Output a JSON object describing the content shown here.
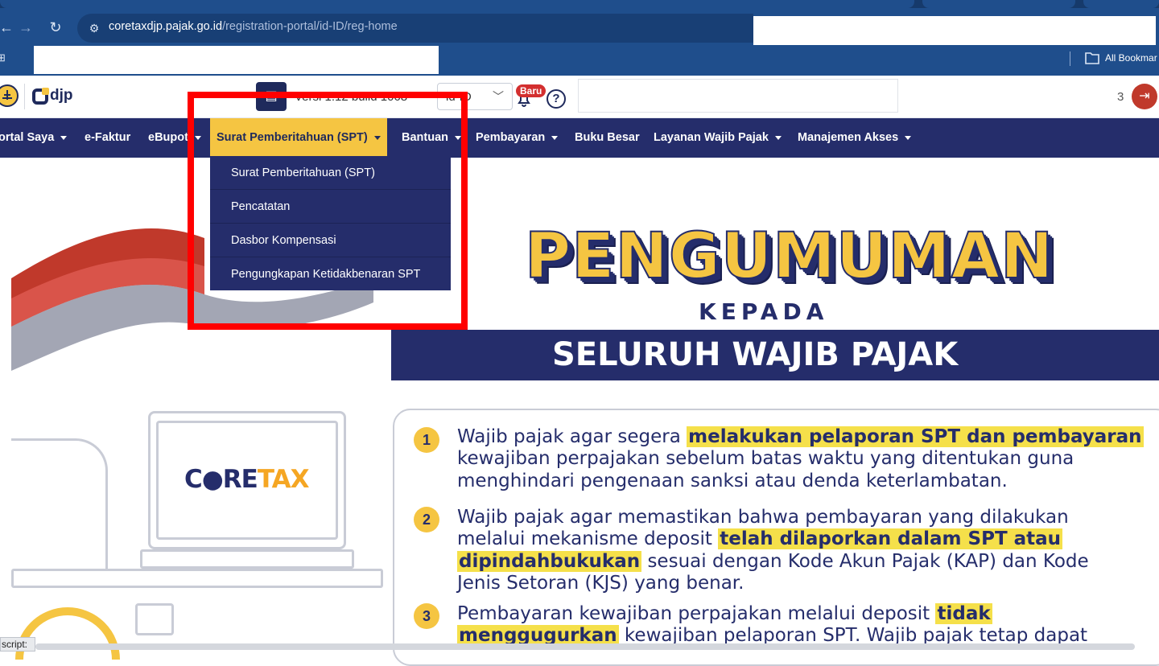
{
  "browser": {
    "url_domain": "coretaxdjp.pajak.go.id",
    "url_path": "/registration-portal/id-ID/reg-home",
    "bookmarks_label": "All Bookmar"
  },
  "header": {
    "logo_text": "djp",
    "version_text": "Versi 1.12 build 1068",
    "language": "id-ID",
    "badge": "Baru",
    "help": "?",
    "user_suffix": "3"
  },
  "nav": {
    "items": [
      {
        "label": "ortal Saya",
        "caret": true
      },
      {
        "label": "e-Faktur",
        "caret": false
      },
      {
        "label": "eBupot",
        "caret": true
      },
      {
        "label": "Surat Pemberitahuan (SPT)",
        "caret": true
      },
      {
        "label": "Bantuan",
        "caret": true
      },
      {
        "label": "Pembayaran",
        "caret": true
      },
      {
        "label": "Buku Besar",
        "caret": false
      },
      {
        "label": "Layanan Wajib Pajak",
        "caret": true
      },
      {
        "label": "Manajemen Akses",
        "caret": true
      }
    ],
    "dropdown": [
      "Surat Pemberitahuan (SPT)",
      "Pencatatan",
      "Dasbor Kompensasi",
      "Pengungkapan Ketidakbenaran SPT"
    ]
  },
  "banner": {
    "title": "PENGUMUMAN",
    "subtitle": "KEPADA",
    "audience": "SELURUH WAJIB PAJAK",
    "logo_core": "C●RE",
    "logo_tax": "TAX",
    "notices": [
      {
        "number": "1",
        "lines": [
          [
            "Wajib pajak agar segera ",
            "melakukan pelaporan SPT dan pembayaran"
          ],
          [
            "kewajiban perpajakan sebelum batas waktu yang ditentukan guna",
            ""
          ],
          [
            "menghindari pengenaan sanksi atau denda keterlambatan.",
            ""
          ]
        ]
      },
      {
        "number": "2",
        "lines": [
          [
            "Wajib pajak agar memastikan bahwa pembayaran yang dilakukan",
            ""
          ],
          [
            "melalui mekanisme deposit ",
            "telah dilaporkan dalam SPT atau"
          ],
          [
            "",
            "dipindahbukukan",
            " sesuai dengan Kode Akun Pajak (KAP) dan Kode"
          ],
          [
            "Jenis Setoran (KJS) yang benar.",
            ""
          ]
        ]
      },
      {
        "number": "3",
        "lines": [
          [
            "Pembayaran kewajiban perpajakan melalui deposit ",
            "tidak"
          ],
          [
            "",
            "menggugurkan",
            " kewajiban pelaporan SPT. Wajib pajak tetap dapat"
          ]
        ]
      }
    ]
  },
  "status": {
    "text": "script:"
  },
  "colors": {
    "navy": "#252d6b",
    "yellow": "#f5c542",
    "highlight_red": "#ff0000"
  }
}
